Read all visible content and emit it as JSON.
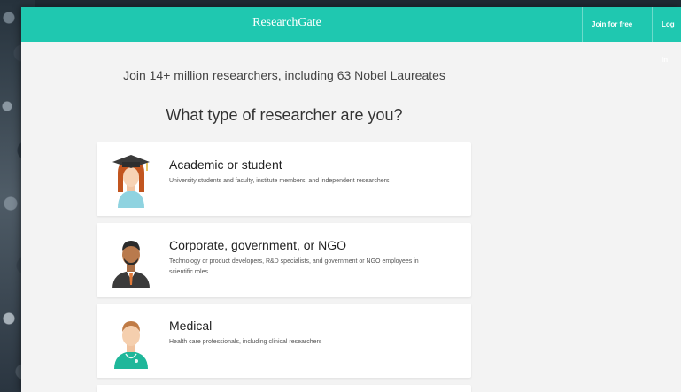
{
  "header": {
    "brand": "ResearchGate",
    "join_label": "Join for free",
    "login_label": "Log in"
  },
  "main": {
    "tagline": "Join 14+ million researchers, including 63 Nobel Laureates",
    "question": "What type of researcher are you?",
    "options": [
      {
        "title": "Academic or student",
        "description": "University students and faculty, institute members, and independent researchers",
        "icon": "graduate-avatar-icon"
      },
      {
        "title": "Corporate, government, or NGO",
        "description": "Technology or product developers, R&D specialists, and government or NGO employees in scientific roles",
        "icon": "business-avatar-icon"
      },
      {
        "title": "Medical",
        "description": "Health care professionals, including clinical researchers",
        "icon": "medical-avatar-icon"
      }
    ]
  },
  "colors": {
    "brand": "#1fc8b0",
    "page_background": "#f3f3f3",
    "card_background": "#ffffff"
  }
}
